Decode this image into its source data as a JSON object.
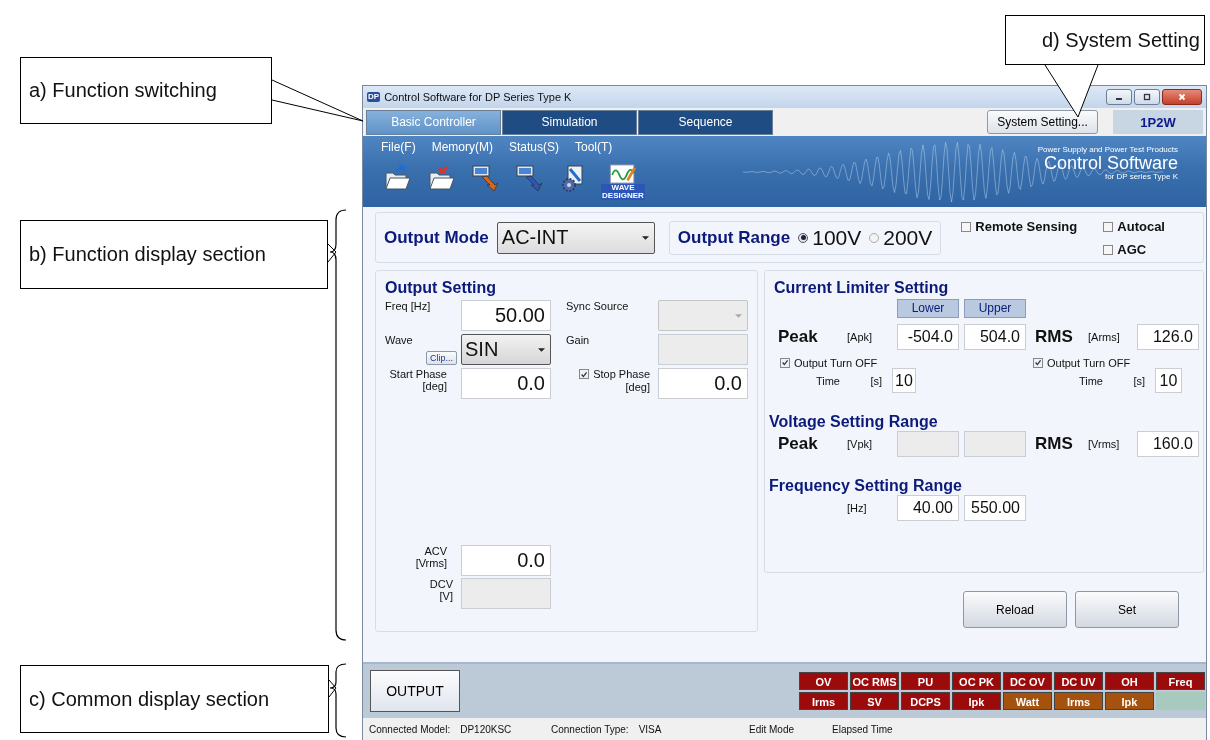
{
  "callouts": [
    {
      "label": "a) Function switching"
    },
    {
      "label": "b) Function display section"
    },
    {
      "label": "c) Common display section"
    },
    {
      "label": "d) System Setting"
    }
  ],
  "window": {
    "app_icon": "DP",
    "title": "Control Software for DP Series Type K"
  },
  "tabs": [
    {
      "label": "Basic Controller",
      "selected": true
    },
    {
      "label": "Simulation",
      "selected": false
    },
    {
      "label": "Sequence",
      "selected": false
    }
  ],
  "system_button": "System Setting...",
  "wiring": "1P2W",
  "menu": [
    "File(F)",
    "Memory(M)",
    "Status(S)",
    "Tool(T)"
  ],
  "toolbar": [
    {
      "kind": "folder-blue"
    },
    {
      "kind": "folder-red"
    },
    {
      "kind": "device-down"
    },
    {
      "kind": "device-up"
    },
    {
      "kind": "gear"
    },
    {
      "kind": "wave",
      "label": "WAVE DESIGNER"
    }
  ],
  "brand": {
    "tagline": "Power Supply and Power Test Products",
    "name": "Control Software",
    "subtitle": "for DP series Type K"
  },
  "output_mode": {
    "label": "Output Mode",
    "value": "AC-INT"
  },
  "output_range": {
    "label": "Output Range",
    "options": [
      {
        "label": "100V",
        "selected": true
      },
      {
        "label": "200V",
        "selected": false
      }
    ]
  },
  "options": [
    {
      "label": "Remote Sensing",
      "checked": false
    },
    {
      "label": "Autocal",
      "checked": false
    },
    {
      "label": "AGC",
      "checked": false
    }
  ],
  "output_setting": {
    "title": "Output Setting",
    "fields": [
      {
        "label": "Freq [Hz]",
        "kind": "input",
        "value": "50.00",
        "disabled": false
      },
      {
        "label": "Sync Source",
        "kind": "select",
        "disabled": true
      },
      {
        "label": "Wave",
        "button": "Clip...",
        "kind": "select",
        "value": "SIN",
        "disabled": false
      },
      {
        "label": "Gain",
        "kind": "input",
        "disabled": true
      },
      {
        "label": "Start Phase",
        "unit": "[deg]",
        "kind": "input",
        "value": "0.0",
        "disabled": false
      },
      {
        "label": "Stop Phase",
        "unit": "[deg]",
        "checked": true,
        "kind": "input",
        "value": "0.0",
        "disabled": false
      }
    ],
    "readings": [
      {
        "label": "ACV",
        "unit": "[Vrms]",
        "value": "0.0",
        "disabled": false
      },
      {
        "label": "DCV",
        "unit": "[V]",
        "disabled": true
      }
    ]
  },
  "current_limiter": {
    "title": "Current Limiter Setting",
    "headers": [
      "Lower",
      "Upper"
    ],
    "peak": {
      "label": "Peak",
      "unit": "[Apk]",
      "values": [
        {
          "value": "-504.0",
          "disabled": false
        },
        {
          "value": "504.0",
          "disabled": false
        }
      ]
    },
    "rms": {
      "label": "RMS",
      "unit": "[Arms]",
      "value": "126.0",
      "disabled": false
    },
    "turn_off": [
      {
        "label": "Output Turn OFF",
        "checked": true,
        "time_label": "Time",
        "unit": "[s]",
        "value": "10",
        "disabled": false
      },
      {
        "label": "Output Turn OFF",
        "checked": true,
        "time_label": "Time",
        "unit": "[s]",
        "value": "10",
        "disabled": false
      }
    ]
  },
  "voltage_range": {
    "title": "Voltage Setting Range",
    "peak": {
      "label": "Peak",
      "unit": "[Vpk]",
      "values": [
        {
          "disabled": true
        },
        {
          "disabled": true
        }
      ]
    },
    "rms": {
      "label": "RMS",
      "unit": "[Vrms]",
      "value": "160.0",
      "disabled": false
    }
  },
  "frequency_range": {
    "title": "Frequency Setting Range",
    "unit": "[Hz]",
    "values": [
      {
        "value": "40.00",
        "disabled": false
      },
      {
        "value": "550.00",
        "disabled": false
      }
    ]
  },
  "actions": [
    "Reload",
    "Set"
  ],
  "output_button": "OUTPUT",
  "alarms": [
    {
      "label": "OV",
      "color": "#9c0b0b"
    },
    {
      "label": "OC RMS",
      "color": "#9c0b0b"
    },
    {
      "label": "PU",
      "color": "#9c0b0b"
    },
    {
      "label": "OC PK",
      "color": "#9c0b0b"
    },
    {
      "label": "DC OV",
      "color": "#9c0b0b"
    },
    {
      "label": "DC UV",
      "color": "#9c0b0b"
    },
    {
      "label": "OH",
      "color": "#9c0b0b"
    },
    {
      "label": "Freq",
      "color": "#9c0b0b"
    },
    {
      "label": "Irms",
      "color": "#9c0b0b"
    },
    {
      "label": "SV",
      "color": "#9c0b0b"
    },
    {
      "label": "DCPS",
      "color": "#9c0b0b"
    },
    {
      "label": "Ipk",
      "color": "#9c0b0b"
    },
    {
      "label": "Watt",
      "color": "#a5520f"
    },
    {
      "label": "Irms",
      "color": "#a5520f"
    },
    {
      "label": "Ipk",
      "color": "#a5520f"
    }
  ],
  "status_bar": [
    {
      "label": "Connected Model:",
      "value": "DP120KSC"
    },
    {
      "label": "Connection Type:",
      "value": "VISA"
    },
    {
      "label": "Edit Mode"
    },
    {
      "label": "Elapsed Time"
    }
  ]
}
